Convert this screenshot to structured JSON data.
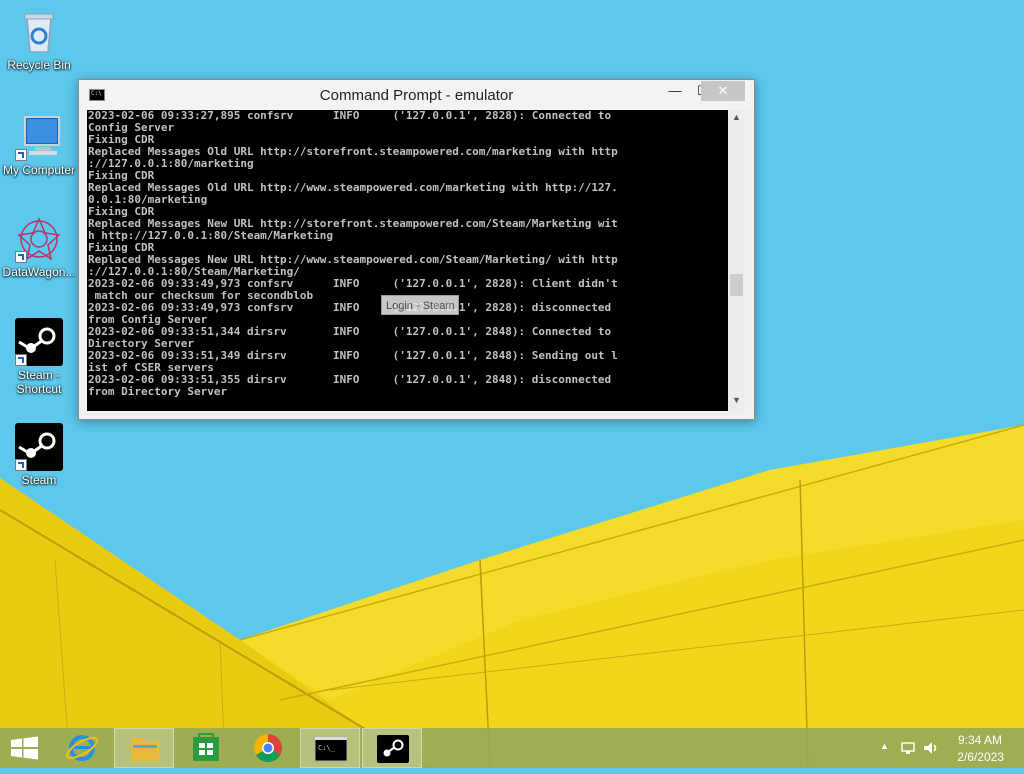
{
  "desktop": {
    "icons": [
      {
        "label": "Recycle Bin",
        "icon": "recycle-bin-icon"
      },
      {
        "label": "My Computer",
        "icon": "computer-icon"
      },
      {
        "label": "DataWagon...",
        "icon": "datawagon-icon"
      },
      {
        "label": "Steam - Shortcut",
        "icon": "steam-icon"
      },
      {
        "label": "Steam",
        "icon": "steam-icon"
      }
    ]
  },
  "window": {
    "title": "Command Prompt - emulator",
    "min_label": "—",
    "max_label": "☐",
    "close_label": "✕",
    "console_lines": [
      "2023-02-06 09:33:27,895 confsrv      INFO     ('127.0.0.1', 2828): Connected to",
      "Config Server",
      "Fixing CDR",
      "Replaced Messages Old URL http://storefront.steampowered.com/marketing with http",
      "://127.0.0.1:80/marketing",
      "Fixing CDR",
      "Replaced Messages Old URL http://www.steampowered.com/marketing with http://127.",
      "0.0.1:80/marketing",
      "Fixing CDR",
      "Replaced Messages New URL http://storefront.steampowered.com/Steam/Marketing wit",
      "h http://127.0.0.1:80/Steam/Marketing",
      "Fixing CDR",
      "Replaced Messages New URL http://www.steampowered.com/Steam/Marketing/ with http",
      "://127.0.0.1:80/Steam/Marketing/",
      "2023-02-06 09:33:49,973 confsrv      INFO     ('127.0.0.1', 2828): Client didn't",
      " match our checksum for secondblob",
      "2023-02-06 09:33:49,973 confsrv      INFO     ('127.0.0.1', 2828): disconnected",
      "from Config Server",
      "2023-02-06 09:33:51,344 dirsrv       INFO     ('127.0.0.1', 2848): Connected to",
      "Directory Server",
      "2023-02-06 09:33:51,349 dirsrv       INFO     ('127.0.0.1', 2848): Sending out l",
      "ist of CSER servers",
      "2023-02-06 09:33:51,355 dirsrv       INFO     ('127.0.0.1', 2848): disconnected",
      "from Directory Server"
    ],
    "tooltip": "Login - Steam"
  },
  "taskbar": {
    "items": [
      {
        "label": "Start",
        "icon": "windows-start-icon"
      },
      {
        "label": "Internet Explorer",
        "icon": "internet-explorer-icon"
      },
      {
        "label": "File Explorer",
        "icon": "file-explorer-icon"
      },
      {
        "label": "Store",
        "icon": "store-icon"
      },
      {
        "label": "Google Chrome",
        "icon": "chrome-icon"
      },
      {
        "label": "Command Prompt",
        "icon": "command-prompt-icon"
      },
      {
        "label": "Steam",
        "icon": "steam-icon"
      }
    ],
    "time": "9:34 AM",
    "date": "2/6/2023"
  }
}
